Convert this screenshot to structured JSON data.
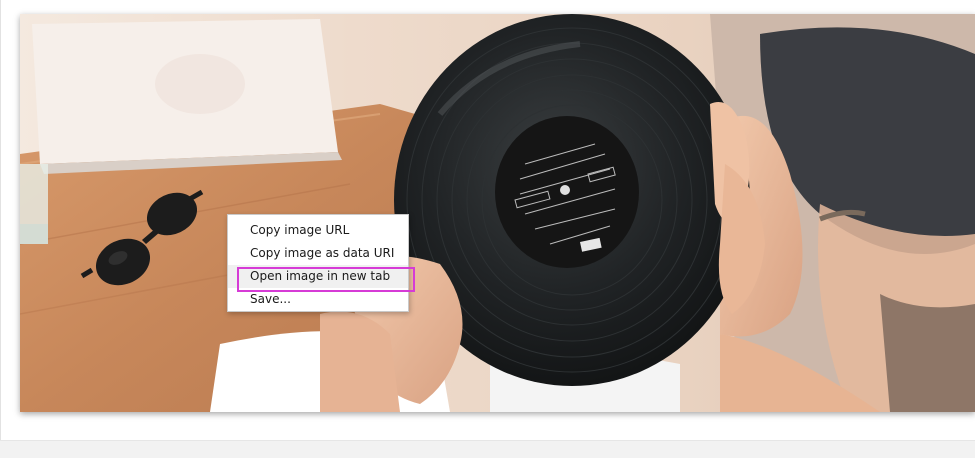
{
  "context_menu": {
    "items": [
      {
        "label": "Copy image URL"
      },
      {
        "label": "Copy image as data URI"
      },
      {
        "label": "Open image in new tab"
      },
      {
        "label": "Save..."
      }
    ],
    "highlighted_index": 2
  },
  "colors": {
    "highlight_outline": "#d63bd6",
    "menu_background": "#ffffff",
    "menu_border": "#c9c9c9",
    "vinyl": "#1d2021",
    "label": "#151515",
    "wood": "#c98a5a",
    "table_light": "#f3e7dc"
  },
  "photo": {
    "subject": "hands holding a vinyl record over a wooden table with sunglasses"
  }
}
